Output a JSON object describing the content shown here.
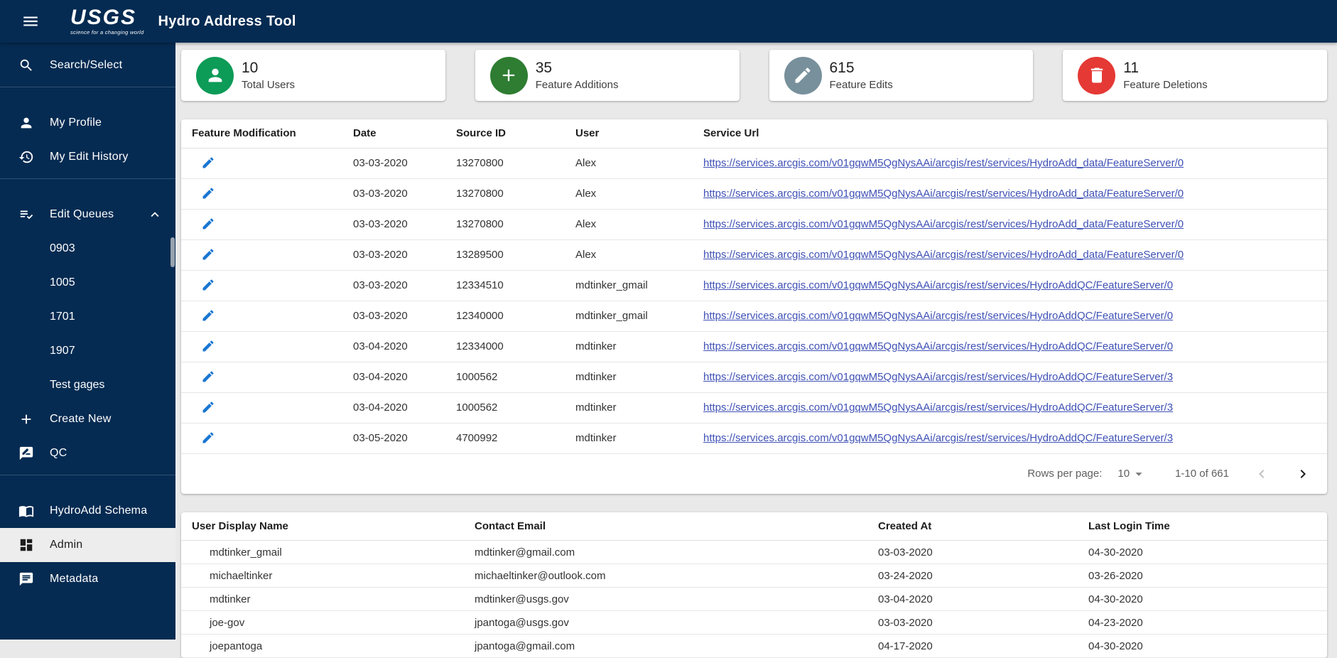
{
  "colors": {
    "navy": "#052b52",
    "active_item_bg": "#ededed",
    "stat_users_green": "#0d9b58",
    "stat_additions_green": "#2e7d32",
    "stat_edits_gray": "#78909c",
    "stat_deletions_red": "#e53935",
    "edit_pencil_blue": "#1976d2",
    "link_blue": "#3f51b5"
  },
  "header": {
    "logo_text": "USGS",
    "logo_tagline": "science for a changing world",
    "title": "Hydro Address Tool"
  },
  "sidebar": {
    "search_select": "Search/Select",
    "my_profile": "My Profile",
    "my_edit_history": "My Edit History",
    "edit_queues": "Edit Queues",
    "queues": [
      "0903",
      "1005",
      "1701",
      "1907",
      "Test gages"
    ],
    "create_new": "Create New",
    "qc": "QC",
    "hydroadd_schema": "HydroAdd Schema",
    "admin": "Admin",
    "metadata": "Metadata"
  },
  "stats": [
    {
      "value": "10",
      "label": "Total Users",
      "icon": "person-icon"
    },
    {
      "value": "35",
      "label": "Feature Additions",
      "icon": "plus-icon"
    },
    {
      "value": "615",
      "label": "Feature Edits",
      "icon": "pencil-icon"
    },
    {
      "value": "11",
      "label": "Feature Deletions",
      "icon": "trash-icon"
    }
  ],
  "edits_table": {
    "columns": [
      "Feature Modification",
      "Date",
      "Source ID",
      "User",
      "Service Url"
    ],
    "rows": [
      {
        "date": "03-03-2020",
        "source_id": "13270800",
        "user": "Alex",
        "url": "https://services.arcgis.com/v01gqwM5QgNysAAi/arcgis/rest/services/HydroAdd_data/FeatureServer/0"
      },
      {
        "date": "03-03-2020",
        "source_id": "13270800",
        "user": "Alex",
        "url": "https://services.arcgis.com/v01gqwM5QgNysAAi/arcgis/rest/services/HydroAdd_data/FeatureServer/0"
      },
      {
        "date": "03-03-2020",
        "source_id": "13270800",
        "user": "Alex",
        "url": "https://services.arcgis.com/v01gqwM5QgNysAAi/arcgis/rest/services/HydroAdd_data/FeatureServer/0"
      },
      {
        "date": "03-03-2020",
        "source_id": "13289500",
        "user": "Alex",
        "url": "https://services.arcgis.com/v01gqwM5QgNysAAi/arcgis/rest/services/HydroAdd_data/FeatureServer/0"
      },
      {
        "date": "03-03-2020",
        "source_id": "12334510",
        "user": "mdtinker_gmail",
        "url": "https://services.arcgis.com/v01gqwM5QgNysAAi/arcgis/rest/services/HydroAddQC/FeatureServer/0"
      },
      {
        "date": "03-03-2020",
        "source_id": "12340000",
        "user": "mdtinker_gmail",
        "url": "https://services.arcgis.com/v01gqwM5QgNysAAi/arcgis/rest/services/HydroAddQC/FeatureServer/0"
      },
      {
        "date": "03-04-2020",
        "source_id": "12334000",
        "user": "mdtinker",
        "url": "https://services.arcgis.com/v01gqwM5QgNysAAi/arcgis/rest/services/HydroAddQC/FeatureServer/0"
      },
      {
        "date": "03-04-2020",
        "source_id": "1000562",
        "user": "mdtinker",
        "url": "https://services.arcgis.com/v01gqwM5QgNysAAi/arcgis/rest/services/HydroAddQC/FeatureServer/3"
      },
      {
        "date": "03-04-2020",
        "source_id": "1000562",
        "user": "mdtinker",
        "url": "https://services.arcgis.com/v01gqwM5QgNysAAi/arcgis/rest/services/HydroAddQC/FeatureServer/3"
      },
      {
        "date": "03-05-2020",
        "source_id": "4700992",
        "user": "mdtinker",
        "url": "https://services.arcgis.com/v01gqwM5QgNysAAi/arcgis/rest/services/HydroAddQC/FeatureServer/3"
      }
    ],
    "pagination": {
      "rows_per_page_label": "Rows per page:",
      "rows_per_page": "10",
      "range": "1-10 of 661"
    }
  },
  "users_table": {
    "columns": [
      "User Display Name",
      "Contact Email",
      "Created At",
      "Last Login Time"
    ],
    "rows": [
      {
        "name": "mdtinker_gmail",
        "email": "mdtinker@gmail.com",
        "created": "03-03-2020",
        "last_login": "04-30-2020"
      },
      {
        "name": "michaeltinker",
        "email": "michaeltinker@outlook.com",
        "created": "03-24-2020",
        "last_login": "03-26-2020"
      },
      {
        "name": "mdtinker",
        "email": "mdtinker@usgs.gov",
        "created": "03-04-2020",
        "last_login": "04-30-2020"
      },
      {
        "name": "joe-gov",
        "email": "jpantoga@usgs.gov",
        "created": "03-03-2020",
        "last_login": "04-23-2020"
      },
      {
        "name": "joepantoga",
        "email": "jpantoga@gmail.com",
        "created": "04-17-2020",
        "last_login": "04-30-2020"
      }
    ]
  }
}
